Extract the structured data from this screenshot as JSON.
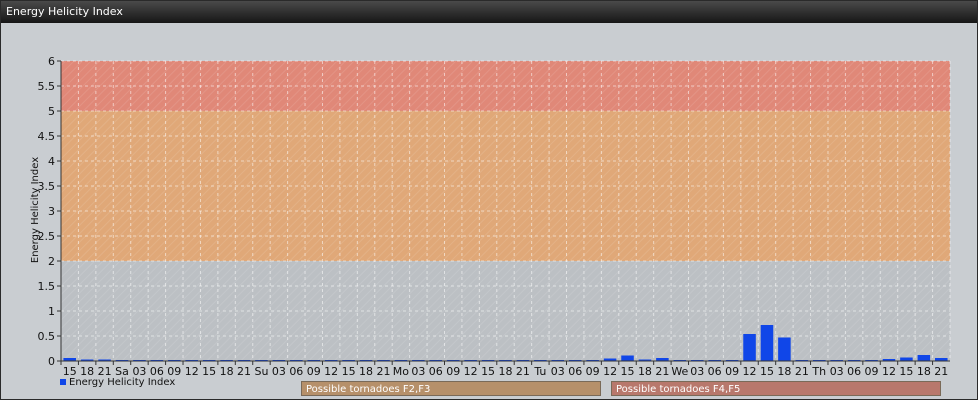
{
  "window": {
    "title": "Energy Helicity Index"
  },
  "chart_data": {
    "type": "bar",
    "title": "",
    "ylabel": "Energy Helicity Index",
    "xlabel": "",
    "ylim": [
      0,
      6
    ],
    "yticks": [
      "0",
      "0.5",
      "1",
      "1.5",
      "2",
      "2.5",
      "3",
      "3.5",
      "4",
      "4.5",
      "5",
      "5.5",
      "6"
    ],
    "bands": [
      {
        "from": 0,
        "to": 2,
        "color": "#bcc0c4"
      },
      {
        "from": 2,
        "to": 5,
        "color": "#e0a878"
      },
      {
        "from": 5,
        "to": 6,
        "color": "#e08878"
      }
    ],
    "categories": [
      "15",
      "18",
      "21",
      "Sa",
      "03",
      "06",
      "09",
      "12",
      "15",
      "18",
      "21",
      "Su",
      "03",
      "06",
      "09",
      "12",
      "15",
      "18",
      "21",
      "Mo",
      "03",
      "06",
      "09",
      "12",
      "15",
      "18",
      "21",
      "Tu",
      "03",
      "06",
      "09",
      "12",
      "15",
      "18",
      "21",
      "We",
      "03",
      "06",
      "09",
      "12",
      "15",
      "18",
      "21",
      "Th",
      "03",
      "06",
      "09",
      "12",
      "15",
      "18",
      "21"
    ],
    "series": [
      {
        "name": "Energy Helicity Index",
        "color": "#1046e8",
        "values": [
          0.06,
          0.03,
          0.03,
          0.02,
          0.02,
          0.02,
          0.02,
          0.02,
          0.02,
          0.02,
          0.02,
          0.02,
          0.02,
          0.02,
          0.02,
          0.02,
          0.02,
          0.02,
          0.02,
          0.02,
          0.02,
          0.02,
          0.02,
          0.02,
          0.02,
          0.02,
          0.02,
          0.02,
          0.02,
          0.02,
          0.02,
          0.05,
          0.11,
          0.03,
          0.06,
          0.02,
          0.02,
          0.02,
          0.02,
          0.54,
          0.72,
          0.47,
          0.02,
          0.02,
          0.02,
          0.02,
          0.02,
          0.04,
          0.07,
          0.12,
          0.06
        ]
      }
    ]
  },
  "zones": [
    {
      "label": "Possible tornadoes F2,F3"
    },
    {
      "label": "Possible tornadoes F4,F5"
    }
  ]
}
